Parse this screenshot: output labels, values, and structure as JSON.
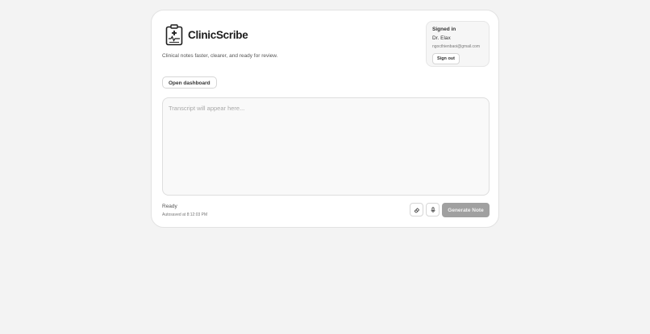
{
  "brand": {
    "name": "ClinicScribe",
    "tagline": "Clinical notes faster, clearer, and ready for review."
  },
  "account": {
    "title": "Signed in",
    "name": "Dr. Elax",
    "email": "ngocthienbaoi@gmail.com",
    "signout_label": "Sign out"
  },
  "actions": {
    "dashboard_label": "Open dashboard",
    "generate_label": "Generate Note"
  },
  "transcript": {
    "value": "",
    "placeholder": "Transcript will appear here..."
  },
  "status": {
    "text": "Ready",
    "autosave": "Autosaved at 8:12:03 PM"
  },
  "icons": {
    "clear": "eraser-icon",
    "record": "microphone-icon"
  },
  "colors": {
    "generate_disabled": "#a0a0a0",
    "page_bg": "#f3f3f3"
  }
}
